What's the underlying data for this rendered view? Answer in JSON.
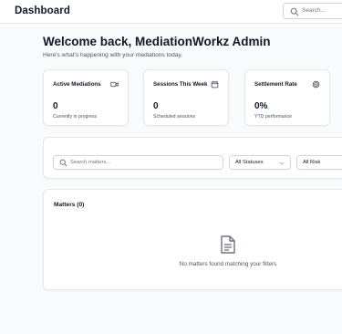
{
  "header": {
    "title": "Dashboard",
    "search_placeholder": "Search..."
  },
  "welcome": {
    "title": "Welcome back, MediationWorkz Admin",
    "subtitle": "Here's what's happening with your mediations today."
  },
  "stats": [
    {
      "label": "Active Mediations",
      "icon": "video-icon",
      "value": "0",
      "description": "Currently in progress"
    },
    {
      "label": "Sessions This Week",
      "icon": "calendar-icon",
      "value": "0",
      "description": "Scheduled sessions"
    },
    {
      "label": "Settlement Rate",
      "icon": "target-icon",
      "value": "0%",
      "description": "YTD performance"
    }
  ],
  "filters": {
    "search_placeholder": "Search matters...",
    "status_select": "All Statuses",
    "risk_select": "All Risk"
  },
  "matters": {
    "title": "Matters (0)",
    "empty_icon": "document-icon",
    "empty_message": "No matters found matching your filters"
  }
}
